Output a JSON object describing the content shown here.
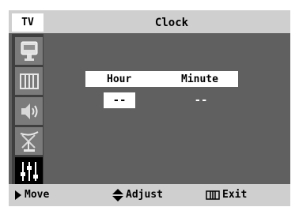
{
  "header": {
    "tv_label": "TV",
    "title": "Clock"
  },
  "sidebar": {
    "items": [
      {
        "icon": "picture-icon",
        "selected": false
      },
      {
        "icon": "channel-icon",
        "selected": false
      },
      {
        "icon": "sound-icon",
        "selected": false
      },
      {
        "icon": "antenna-icon",
        "selected": false
      },
      {
        "icon": "setup-icon",
        "selected": true
      }
    ]
  },
  "clock": {
    "hour_label": "Hour",
    "minute_label": "Minute",
    "hour_value": "--",
    "minute_value": "--"
  },
  "footer": {
    "move_label": "Move",
    "adjust_label": "Adjust",
    "exit_label": "Exit"
  },
  "colors": {
    "panel": "#606060",
    "header": "#cfcfcf",
    "sidebar": "#3f3f3f",
    "sidebar_item": "#7b7b7b",
    "selected_item": "#000000"
  }
}
